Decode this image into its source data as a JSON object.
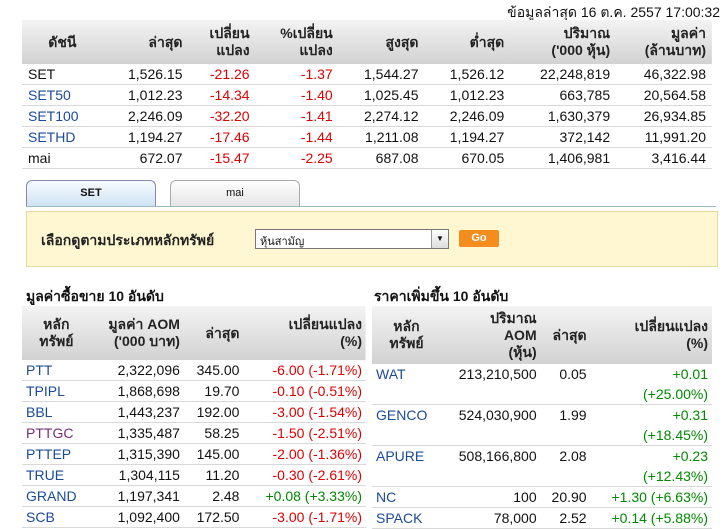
{
  "timestamp": "ข้อมูลล่าสุด 16 ต.ค. 2557 17:00:32",
  "index_table": {
    "headers": [
      "ดัชนี",
      "ล่าสุด",
      "เปลี่ยน\nแปลง",
      "%เปลี่ยน\nแปลง",
      "สูงสุด",
      "ต่ำสุด",
      "ปริมาณ\n('000 หุ้น)",
      "มูลค่า\n(ล้านบาท)"
    ],
    "rows": [
      {
        "name": "SET",
        "last": "1,526.15",
        "chg": "-21.26",
        "pct": "-1.37",
        "high": "1,544.27",
        "low": "1,526.12",
        "vol": "22,248,819",
        "val": "46,322.98"
      },
      {
        "name": "SET50",
        "last": "1,012.23",
        "chg": "-14.34",
        "pct": "-1.40",
        "high": "1,025.45",
        "low": "1,012.23",
        "vol": "663,785",
        "val": "20,564.58"
      },
      {
        "name": "SET100",
        "last": "2,246.09",
        "chg": "-32.20",
        "pct": "-1.41",
        "high": "2,274.12",
        "low": "2,246.09",
        "vol": "1,630,379",
        "val": "26,934.85"
      },
      {
        "name": "SETHD",
        "last": "1,194.27",
        "chg": "-17.46",
        "pct": "-1.44",
        "high": "1,211.08",
        "low": "1,194.27",
        "vol": "372,142",
        "val": "11,991.20"
      },
      {
        "name": "mai",
        "last": "672.07",
        "chg": "-15.47",
        "pct": "-2.25",
        "high": "687.08",
        "low": "670.05",
        "vol": "1,406,981",
        "val": "3,416.44"
      }
    ]
  },
  "tabs": [
    "SET",
    "mai"
  ],
  "filter": {
    "label": "เลือกดูตามประเภทหลักทรัพย์",
    "selected": "หุ้นสามัญ",
    "go": "Go"
  },
  "left_title": "มูลค่าซื้อขาย 10 อันดับ",
  "left_table": {
    "headers": [
      "หลัก\nทรัพย์",
      "มูลค่า AOM\n('000 บาท)",
      "ล่าสุด",
      "เปลี่ยนแปลง\n(%)"
    ],
    "rows": [
      {
        "sym": "PTT",
        "aom": "2,322,096",
        "last": "345.00",
        "chg": "-6.00 (-1.71%)",
        "dir": "neg",
        "color": "lnk"
      },
      {
        "sym": "TPIPL",
        "aom": "1,868,698",
        "last": "19.70",
        "chg": "-0.10 (-0.51%)",
        "dir": "neg",
        "color": "lnk"
      },
      {
        "sym": "BBL",
        "aom": "1,443,237",
        "last": "192.00",
        "chg": "-3.00 (-1.54%)",
        "dir": "neg",
        "color": "lnk"
      },
      {
        "sym": "PTTGC",
        "aom": "1,335,487",
        "last": "58.25",
        "chg": "-1.50 (-2.51%)",
        "dir": "neg",
        "color": "purp"
      },
      {
        "sym": "PTTEP",
        "aom": "1,315,390",
        "last": "145.00",
        "chg": "-2.00 (-1.36%)",
        "dir": "neg",
        "color": "lnk"
      },
      {
        "sym": "TRUE",
        "aom": "1,304,115",
        "last": "11.20",
        "chg": "-0.30 (-2.61%)",
        "dir": "neg",
        "color": "lnk"
      },
      {
        "sym": "GRAND",
        "aom": "1,197,341",
        "last": "2.48",
        "chg": "+0.08 (+3.33%)",
        "dir": "pos",
        "color": "lnk"
      },
      {
        "sym": "SCB",
        "aom": "1,092,400",
        "last": "172.50",
        "chg": "-3.00 (-1.71%)",
        "dir": "neg",
        "color": "lnk"
      }
    ]
  },
  "right_title": "ราคาเพิ่มขึ้น 10 อันดับ",
  "right_table": {
    "headers": [
      "หลัก\nทรัพย์",
      "ปริมาณ\nAOM\n(หุ้น)",
      "ล่าสุด",
      "เปลี่ยนแปลง\n(%)"
    ],
    "rows": [
      {
        "sym": "WAT",
        "vol": "213,210,500",
        "last": "0.05",
        "chg1": "+0.01",
        "chg2": "(+25.00%)"
      },
      {
        "sym": "GENCO",
        "vol": "524,030,900",
        "last": "1.99",
        "chg1": "+0.31",
        "chg2": "(+18.45%)"
      },
      {
        "sym": "APURE",
        "vol": "508,166,800",
        "last": "2.08",
        "chg1": "+0.23",
        "chg2": "(+12.43%)"
      },
      {
        "sym": "NC",
        "vol": "100",
        "last": "20.90",
        "chg1": "+1.30 (+6.63%)",
        "chg2": ""
      },
      {
        "sym": "SPACK",
        "vol": "78,000",
        "last": "2.52",
        "chg1": "+0.14 (+5.88%)",
        "chg2": ""
      }
    ]
  }
}
